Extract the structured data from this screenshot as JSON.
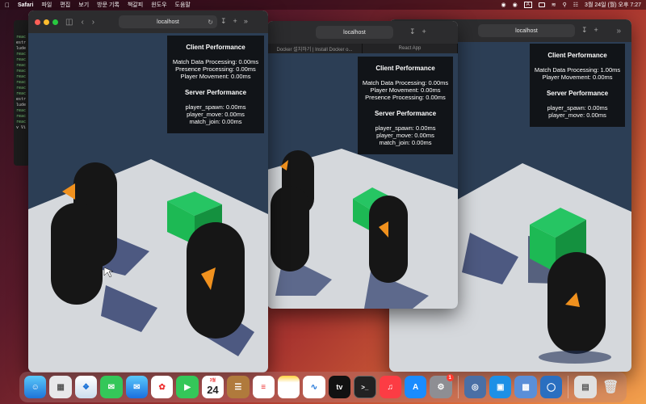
{
  "menubar": {
    "app": "Safari",
    "items": [
      "파일",
      "편집",
      "보기",
      "방문 기록",
      "책갈피",
      "윈도우",
      "도움말"
    ],
    "datetime": "3월 24일 (월) 오후 7:27",
    "input_indicator": "A"
  },
  "terminal": {
    "lines": [
      "reac",
      "estr",
      "lude",
      "reac",
      "reac",
      "reac",
      "reac",
      "reac",
      "reac",
      "reac",
      "reac",
      "estr",
      "lude",
      "reac",
      "reac",
      "reac",
      "v Vi"
    ]
  },
  "windows": [
    {
      "url": "localhost",
      "client_title": "Client Performance",
      "client_lines": [
        "Match Data Processing: 0.00ms",
        "Presence Processing: 0.00ms",
        "Player Movement: 0.00ms"
      ],
      "server_title": "Server Performance",
      "server_lines": [
        "player_spawn: 0.00ms",
        "player_move: 0.00ms",
        "match_join: 0.00ms"
      ]
    },
    {
      "url": "localhost",
      "tabs": [
        "Docker 설치하기 | Install Docker o...",
        "React App"
      ],
      "client_title": "Client Performance",
      "client_lines": [
        "Match Data Processing: 0.00ms",
        "Player Movement: 0.00ms",
        "Presence Processing: 0.00ms"
      ],
      "server_title": "Server Performance",
      "server_lines": [
        "player_spawn: 0.00ms",
        "player_move: 0.00ms",
        "match_join: 0.00ms"
      ]
    },
    {
      "url": "localhost",
      "client_title": "Client Performance",
      "client_lines": [
        "Match Data Processing: 1.00ms",
        "Player Movement: 0.00ms"
      ],
      "server_title": "Server Performance",
      "server_lines": [
        "player_spawn: 0.00ms",
        "player_move: 0.00ms"
      ]
    }
  ],
  "dock": {
    "apps": [
      "Finder",
      "Launchpad",
      "Safari",
      "Messages",
      "Mail",
      "Photos",
      "FaceTime",
      "Calendar",
      "Notes-brown",
      "Reminders",
      "Notes",
      "Freeform",
      "TV",
      "Terminal",
      "Music",
      "App Store",
      "System Settings",
      "Activity",
      "Docker",
      "Preview",
      "Simulator",
      "Downloads",
      "Trash"
    ],
    "calendar_month": "3월",
    "calendar_day": "24",
    "tv_label": "tv",
    "settings_badge": "1"
  },
  "colors": {
    "ground": "#d5d8dc",
    "sky": "#2c3e55",
    "cube": "#1db954",
    "player": "#161616",
    "beak": "#f0911e"
  }
}
